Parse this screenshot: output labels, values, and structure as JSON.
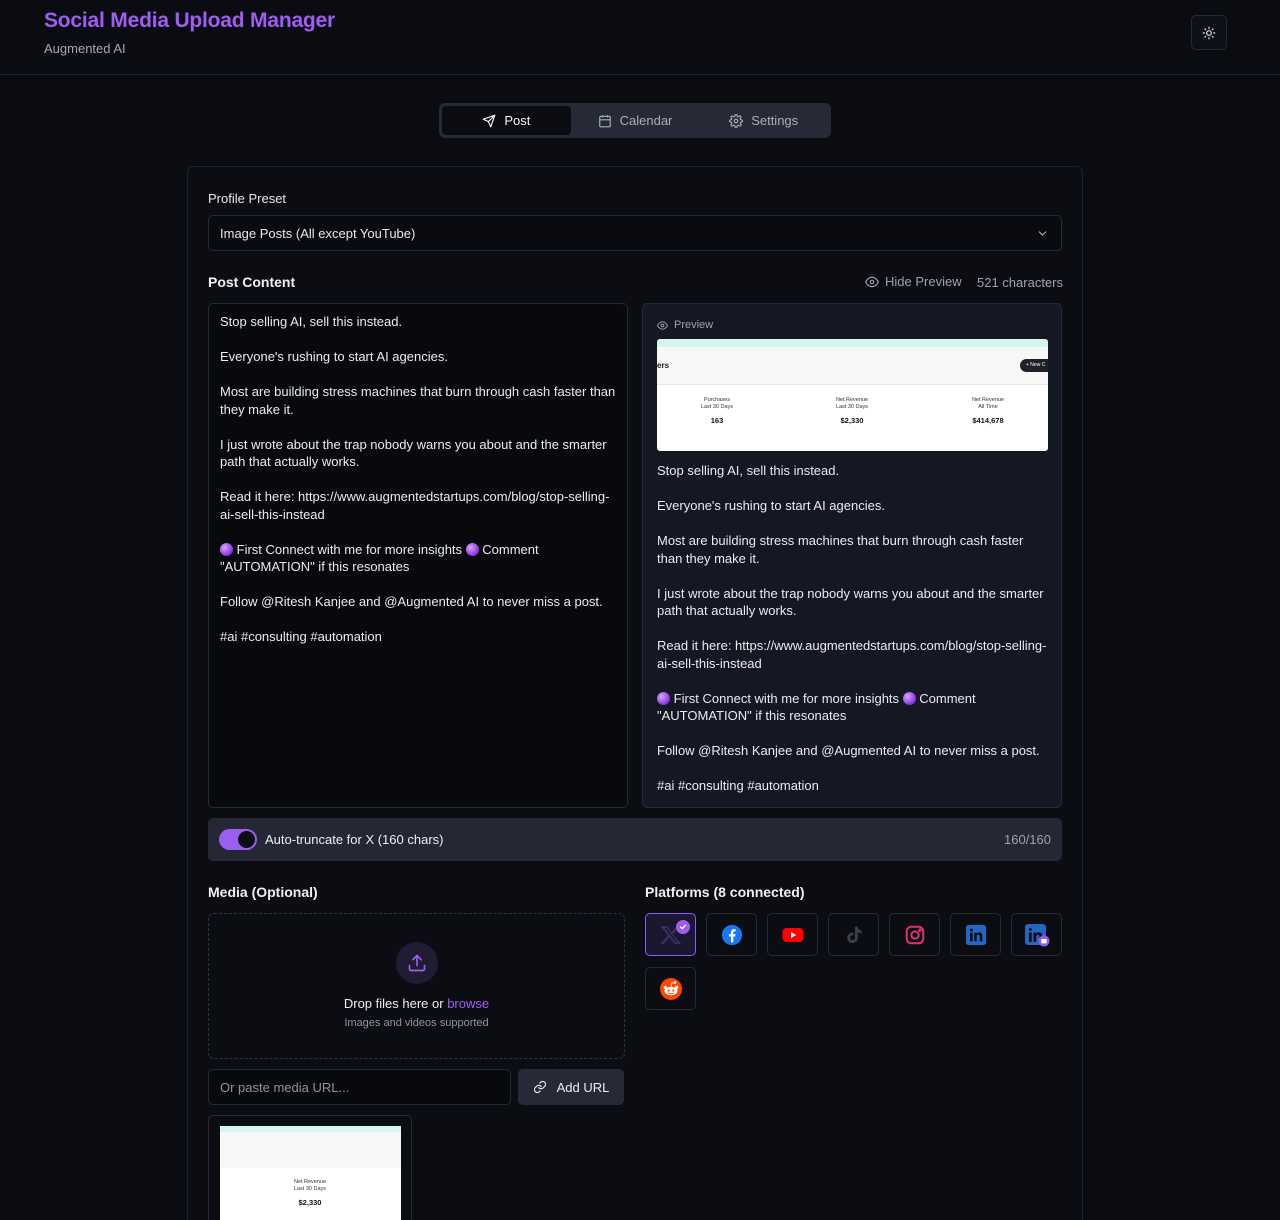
{
  "header": {
    "title": "Social Media Upload Manager",
    "subtitle": "Augmented AI",
    "theme_icon": "sun-icon"
  },
  "tabs": [
    {
      "label": "Post",
      "icon": "send-icon",
      "active": true
    },
    {
      "label": "Calendar",
      "icon": "calendar-icon",
      "active": false
    },
    {
      "label": "Settings",
      "icon": "gear-icon",
      "active": false
    }
  ],
  "profile_preset": {
    "label": "Profile Preset",
    "selected": "Image Posts (All except YouTube)"
  },
  "post_content": {
    "title": "Post Content",
    "hide_preview_label": "Hide Preview",
    "character_count": "521 characters",
    "paragraphs": [
      "Stop selling AI, sell this instead.",
      "Everyone's rushing to start AI agencies.",
      "Most are building stress machines that burn through cash faster than they make it.",
      "I just wrote about the trap nobody warns you about and the smarter path that actually works.",
      "Read it here: https://www.augmentedstartups.com/blog/stop-selling-ai-sell-this-instead",
      "First Connect with me for more insights",
      "Comment \"AUTOMATION\" if this resonates",
      "Follow @Ritesh Kanjee and @Augmented AI to never miss a post.",
      "#ai #consulting #automation"
    ]
  },
  "preview": {
    "label": "Preview",
    "image": {
      "partial_title": "ers",
      "new_button": "+ New C",
      "stats": [
        {
          "line1": "Purchases",
          "line2": "Last 30 Days",
          "value": "163"
        },
        {
          "line1": "Net Revenue",
          "line2": "Last 30 Days",
          "value": "$2,330"
        },
        {
          "line1": "Net Revenue",
          "line2": "All Time",
          "value": "$414,678"
        }
      ]
    }
  },
  "auto_truncate": {
    "label": "Auto-truncate for X (160 chars)",
    "enabled": true,
    "count": "160/160",
    "accent": "#9b5ef0"
  },
  "media": {
    "title": "Media (Optional)",
    "drop_text": "Drop files here or",
    "browse_label": "browse",
    "drop_sub": "Images and videos supported",
    "url_placeholder": "Or paste media URL...",
    "add_url_label": "Add URL",
    "thumbnail": {
      "line1": "Net Revenue",
      "line2": "Last 30 Days",
      "value": "$2,330"
    }
  },
  "platforms": {
    "title": "Platforms (8 connected)",
    "items": [
      {
        "name": "x",
        "icon": "x-icon",
        "selected": true
      },
      {
        "name": "facebook",
        "icon": "facebook-icon",
        "color": "#1877f2"
      },
      {
        "name": "youtube",
        "icon": "youtube-icon",
        "color": "#ff0000"
      },
      {
        "name": "tiktok",
        "icon": "tiktok-icon",
        "color": "#3a3f4b"
      },
      {
        "name": "instagram",
        "icon": "instagram-icon",
        "color": "#e1306c"
      },
      {
        "name": "linkedin",
        "icon": "linkedin-icon",
        "color": "#2566c2"
      },
      {
        "name": "linkedin-page",
        "icon": "linkedin-company-icon",
        "color": "#2566c2"
      },
      {
        "name": "reddit",
        "icon": "reddit-icon",
        "color": "#ff4500"
      }
    ]
  }
}
